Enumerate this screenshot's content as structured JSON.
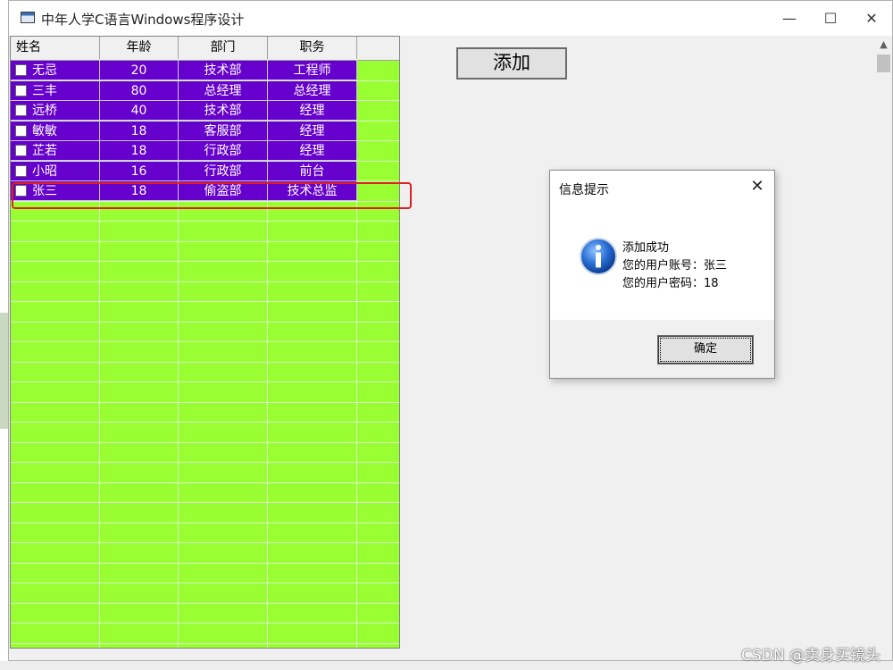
{
  "window": {
    "title": "中年人学C语言Windows程序设计",
    "minimize_glyph": "—",
    "maximize_glyph": "☐",
    "close_glyph": "✕"
  },
  "table": {
    "headers": [
      "姓名",
      "年龄",
      "部门",
      "职务"
    ],
    "rows": [
      {
        "name": "无忌",
        "age": "20",
        "dept": "技术部",
        "title": "工程师"
      },
      {
        "name": "三丰",
        "age": "80",
        "dept": "总经理",
        "title": "总经理"
      },
      {
        "name": "远桥",
        "age": "40",
        "dept": "技术部",
        "title": "经理"
      },
      {
        "name": "敏敏",
        "age": "18",
        "dept": "客服部",
        "title": "经理"
      },
      {
        "name": "芷若",
        "age": "18",
        "dept": "行政部",
        "title": "经理"
      },
      {
        "name": "小昭",
        "age": "16",
        "dept": "行政部",
        "title": "前台"
      },
      {
        "name": "张三",
        "age": "18",
        "dept": "偷盗部",
        "title": "技术总监"
      }
    ],
    "colors": {
      "row_bg": "#6600cc",
      "grid_bg": "#99ff33"
    }
  },
  "add_button": {
    "label": "添加"
  },
  "dialog": {
    "title": "信息提示",
    "icon": "info-icon",
    "lines": [
      "添加成功",
      "您的用户账号：张三",
      "您的用户密码：18"
    ],
    "ok_label": "确定",
    "close_glyph": "✕"
  },
  "highlight": {
    "color": "#e02020"
  },
  "watermark": "CSDN @卖身买镜头"
}
